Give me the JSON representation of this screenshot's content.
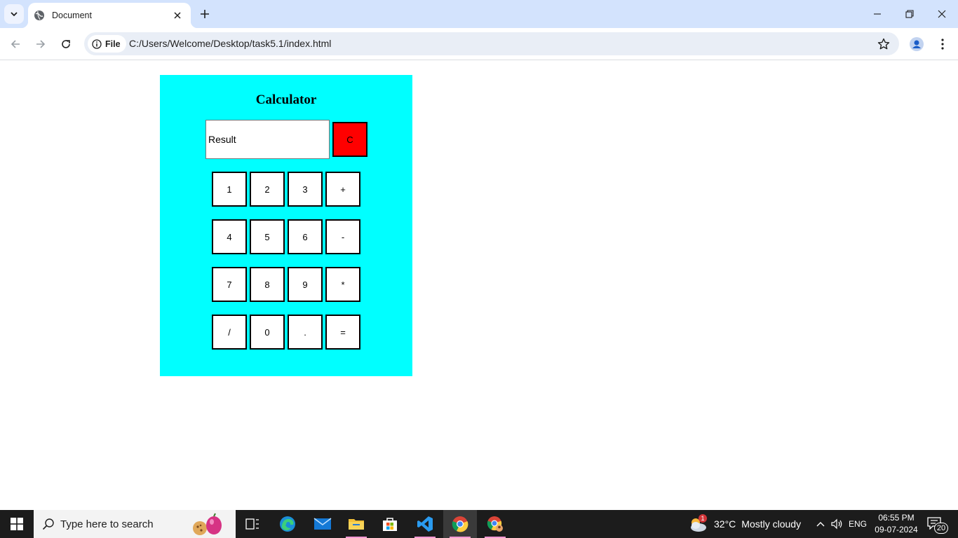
{
  "browser": {
    "tab": {
      "title": "Document"
    },
    "address": {
      "scheme_label": "File",
      "url": "C:/Users/Welcome/Desktop/task5.1/index.html"
    }
  },
  "calculator": {
    "title": "Calculator",
    "result_placeholder": "Result",
    "clear_label": "C",
    "rows": [
      [
        "1",
        "2",
        "3",
        "+"
      ],
      [
        "4",
        "5",
        "6",
        "-"
      ],
      [
        "7",
        "8",
        "9",
        "*"
      ],
      [
        "/",
        "0",
        ".",
        "="
      ]
    ],
    "colors": {
      "panel": "#00ffff",
      "clear": "#ff0000",
      "key": "#ffffff"
    }
  },
  "taskbar": {
    "search_placeholder": "Type here to search",
    "weather": {
      "temp": "32°C",
      "condition": "Mostly cloudy",
      "alert_count": "1"
    },
    "language": "ENG",
    "time": "06:55 PM",
    "date": "09-07-2024",
    "notification_count": "20",
    "apps": [
      "task-view",
      "edge",
      "mail",
      "file-explorer",
      "store",
      "vscode",
      "chrome",
      "chrome-profile"
    ]
  }
}
